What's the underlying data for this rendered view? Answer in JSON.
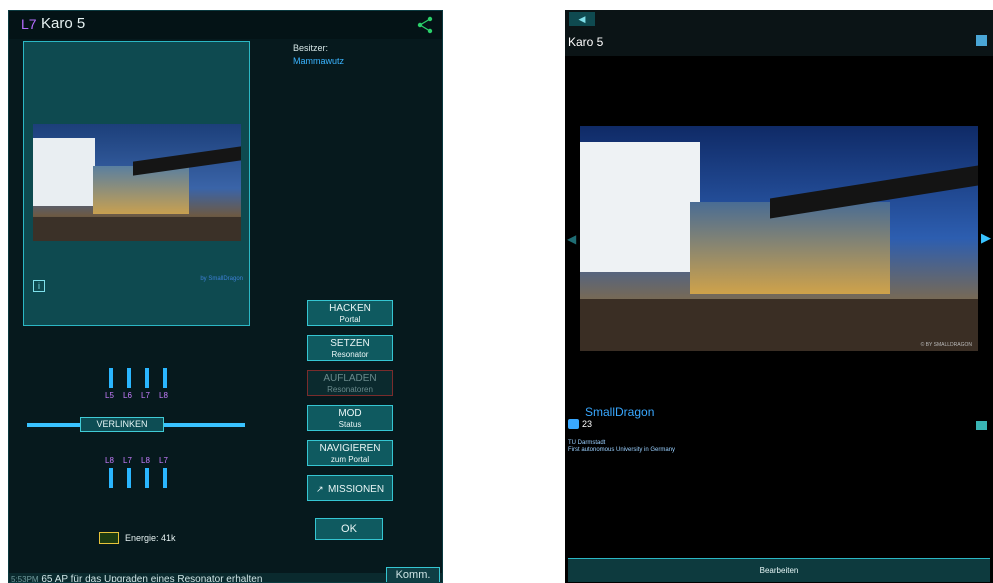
{
  "left": {
    "level": "L7",
    "portal_name": "Karo 5",
    "owner_label": "Besitzer:",
    "owner_name": "Mammawutz",
    "image_credit": "by SmallDragon",
    "info_icon": "i",
    "buttons": [
      {
        "title": "HACKEN",
        "sub": "Portal"
      },
      {
        "title": "SETZEN",
        "sub": "Resonator"
      },
      {
        "title": "AUFLADEN",
        "sub": "Resonatoren"
      },
      {
        "title": "MOD",
        "sub": "Status"
      },
      {
        "title": "NAVIGIEREN",
        "sub": "zum Portal"
      },
      {
        "title": "MISSIONEN",
        "sub": ""
      }
    ],
    "ok_label": "OK",
    "energy_label": "Energie: 41k",
    "link_label": "VERLINKEN",
    "top_resonators": [
      "L5",
      "L6",
      "L7",
      "L8"
    ],
    "bottom_resonators": [
      "L8",
      "L7",
      "L8",
      "L7"
    ],
    "chat": {
      "time": "5:53PM",
      "message": "65 AP für das Upgraden eines Resonator erhalten"
    },
    "komm_label": "Komm."
  },
  "right": {
    "back_icon": "◀",
    "title": "Karo 5",
    "author": "SmallDragon",
    "likes": "23",
    "desc_line1": "TU Darmstadt",
    "desc_line2": "First autonomous University in Germany",
    "photo_credit": "© BY SMALLDRAGON",
    "edit_label": "Bearbeiten"
  },
  "colors": {
    "accent": "#35c6d2",
    "owner": "#3ab4ff",
    "resonator": "#c77dff"
  }
}
